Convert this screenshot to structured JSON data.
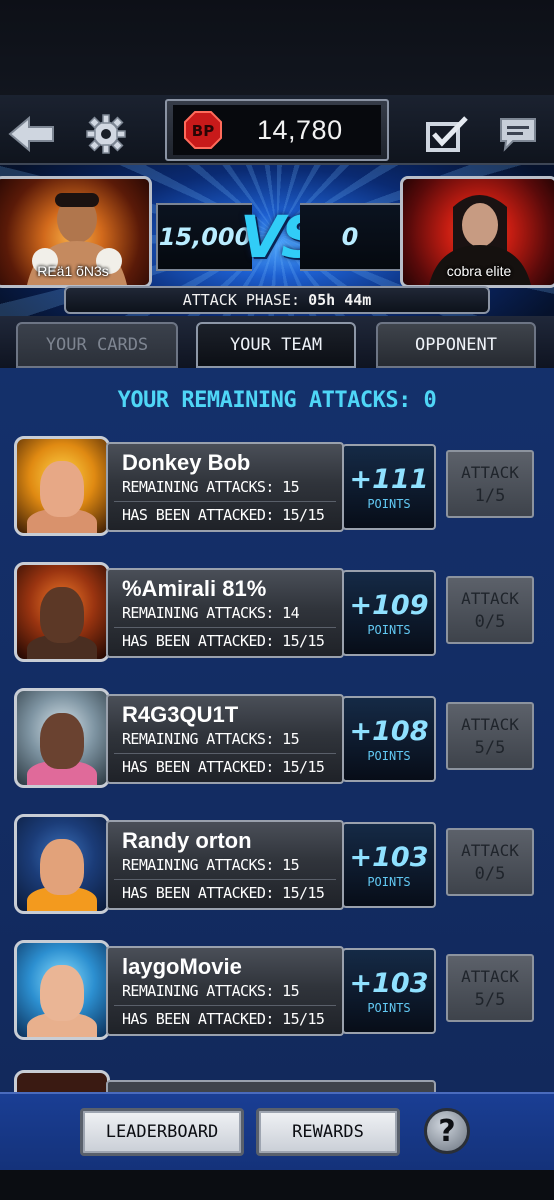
{
  "header": {
    "currency_value": "14,780",
    "currency_icon": "bp-badge-icon",
    "back_icon": "back-arrow-icon",
    "settings_icon": "gear-icon",
    "checklist_icon": "checkbox-icon",
    "chat_icon": "chat-icon"
  },
  "match": {
    "left_player": "REä1 õN3s",
    "right_player": "cobra elite",
    "left_score": "15,000",
    "right_score": "0",
    "vs_text": "VS",
    "phase_label": "ATTACK PHASE:",
    "phase_time": "05h  44m"
  },
  "tabs": {
    "cards": "YOUR CARDS",
    "team": "YOUR TEAM",
    "opponent": "OPPONENT"
  },
  "remaining_attacks_text": "YOUR REMAINING ATTACKS: 0",
  "opponents": [
    {
      "name": "Donkey Bob",
      "remaining": "REMAINING ATTACKS: 15",
      "attacked": "HAS BEEN ATTACKED: 15/15",
      "points": "+111",
      "points_label": "POINTS",
      "attack_label": "ATTACK",
      "attack_count": "1/5"
    },
    {
      "name": "%Amirali 81%",
      "remaining": "REMAINING ATTACKS: 14",
      "attacked": "HAS BEEN ATTACKED: 15/15",
      "points": "+109",
      "points_label": "POINTS",
      "attack_label": "ATTACK",
      "attack_count": "0/5"
    },
    {
      "name": "R4G3QU1T",
      "remaining": "REMAINING ATTACKS: 15",
      "attacked": "HAS BEEN ATTACKED: 15/15",
      "points": "+108",
      "points_label": "POINTS",
      "attack_label": "ATTACK",
      "attack_count": "5/5"
    },
    {
      "name": "Randy orton",
      "remaining": "REMAINING ATTACKS: 15",
      "attacked": "HAS BEEN ATTACKED: 15/15",
      "points": "+103",
      "points_label": "POINTS",
      "attack_label": "ATTACK",
      "attack_count": "0/5"
    },
    {
      "name": "laygoMovie",
      "remaining": "REMAINING ATTACKS: 15",
      "attacked": "HAS BEEN ATTACKED: 15/15",
      "points": "+103",
      "points_label": "POINTS",
      "attack_label": "ATTACK",
      "attack_count": "5/5"
    }
  ],
  "footer": {
    "leaderboard": "LEADERBOARD",
    "rewards": "REWARDS",
    "help": "?"
  },
  "colors": {
    "accent": "#4fd6f6",
    "vs": "#31cdf7",
    "points": "#8fe1ff",
    "content_bg": "#14306b"
  }
}
